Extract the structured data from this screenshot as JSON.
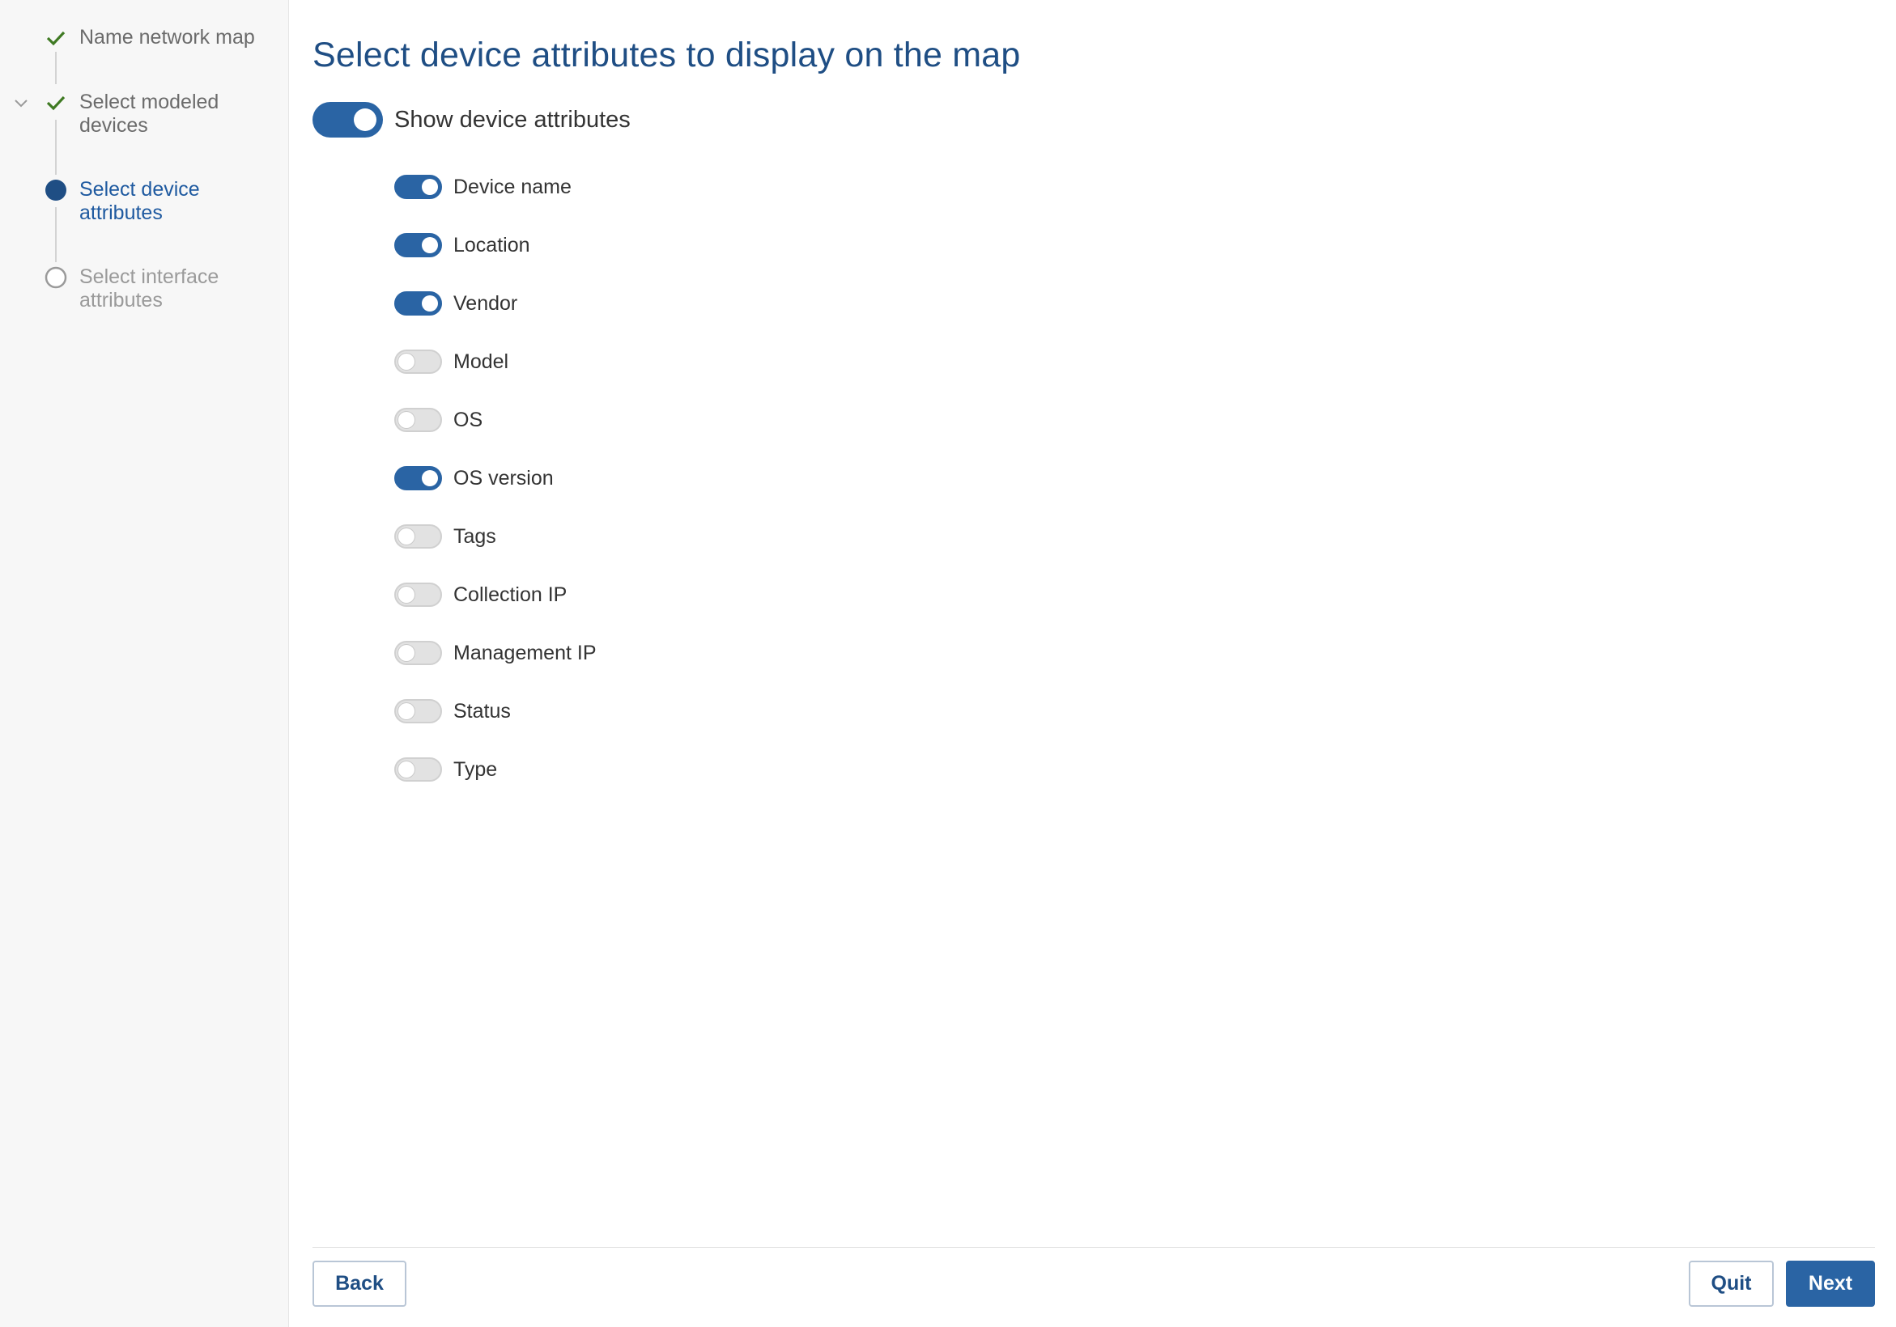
{
  "colors": {
    "accent": "#2a64a4",
    "title": "#1f4e84",
    "check": "#3f7a23",
    "toggle_off": "#e2e2e2"
  },
  "stepper": {
    "steps": [
      {
        "label_line1": "Name network map",
        "label_line2": "",
        "state": "complete",
        "icon": "check-icon"
      },
      {
        "label_line1": "Select modeled",
        "label_line2": "devices",
        "state": "complete",
        "icon": "check-icon"
      },
      {
        "label_line1": "Select device",
        "label_line2": "attributes",
        "state": "current",
        "icon": "filled-circle-icon"
      },
      {
        "label_line1": "Select interface",
        "label_line2": "attributes",
        "state": "pending",
        "icon": "empty-circle-icon"
      }
    ]
  },
  "main": {
    "title": "Select device attributes to display on the map",
    "master_toggle": {
      "label": "Show device attributes",
      "on": true
    },
    "attributes": [
      {
        "label": "Device name",
        "on": true
      },
      {
        "label": "Location",
        "on": true
      },
      {
        "label": "Vendor",
        "on": true
      },
      {
        "label": "Model",
        "on": false
      },
      {
        "label": "OS",
        "on": false
      },
      {
        "label": "OS version",
        "on": true
      },
      {
        "label": "Tags",
        "on": false
      },
      {
        "label": "Collection IP",
        "on": false
      },
      {
        "label": "Management IP",
        "on": false
      },
      {
        "label": "Status",
        "on": false
      },
      {
        "label": "Type",
        "on": false
      }
    ]
  },
  "footer": {
    "back_label": "Back",
    "quit_label": "Quit",
    "next_label": "Next"
  }
}
